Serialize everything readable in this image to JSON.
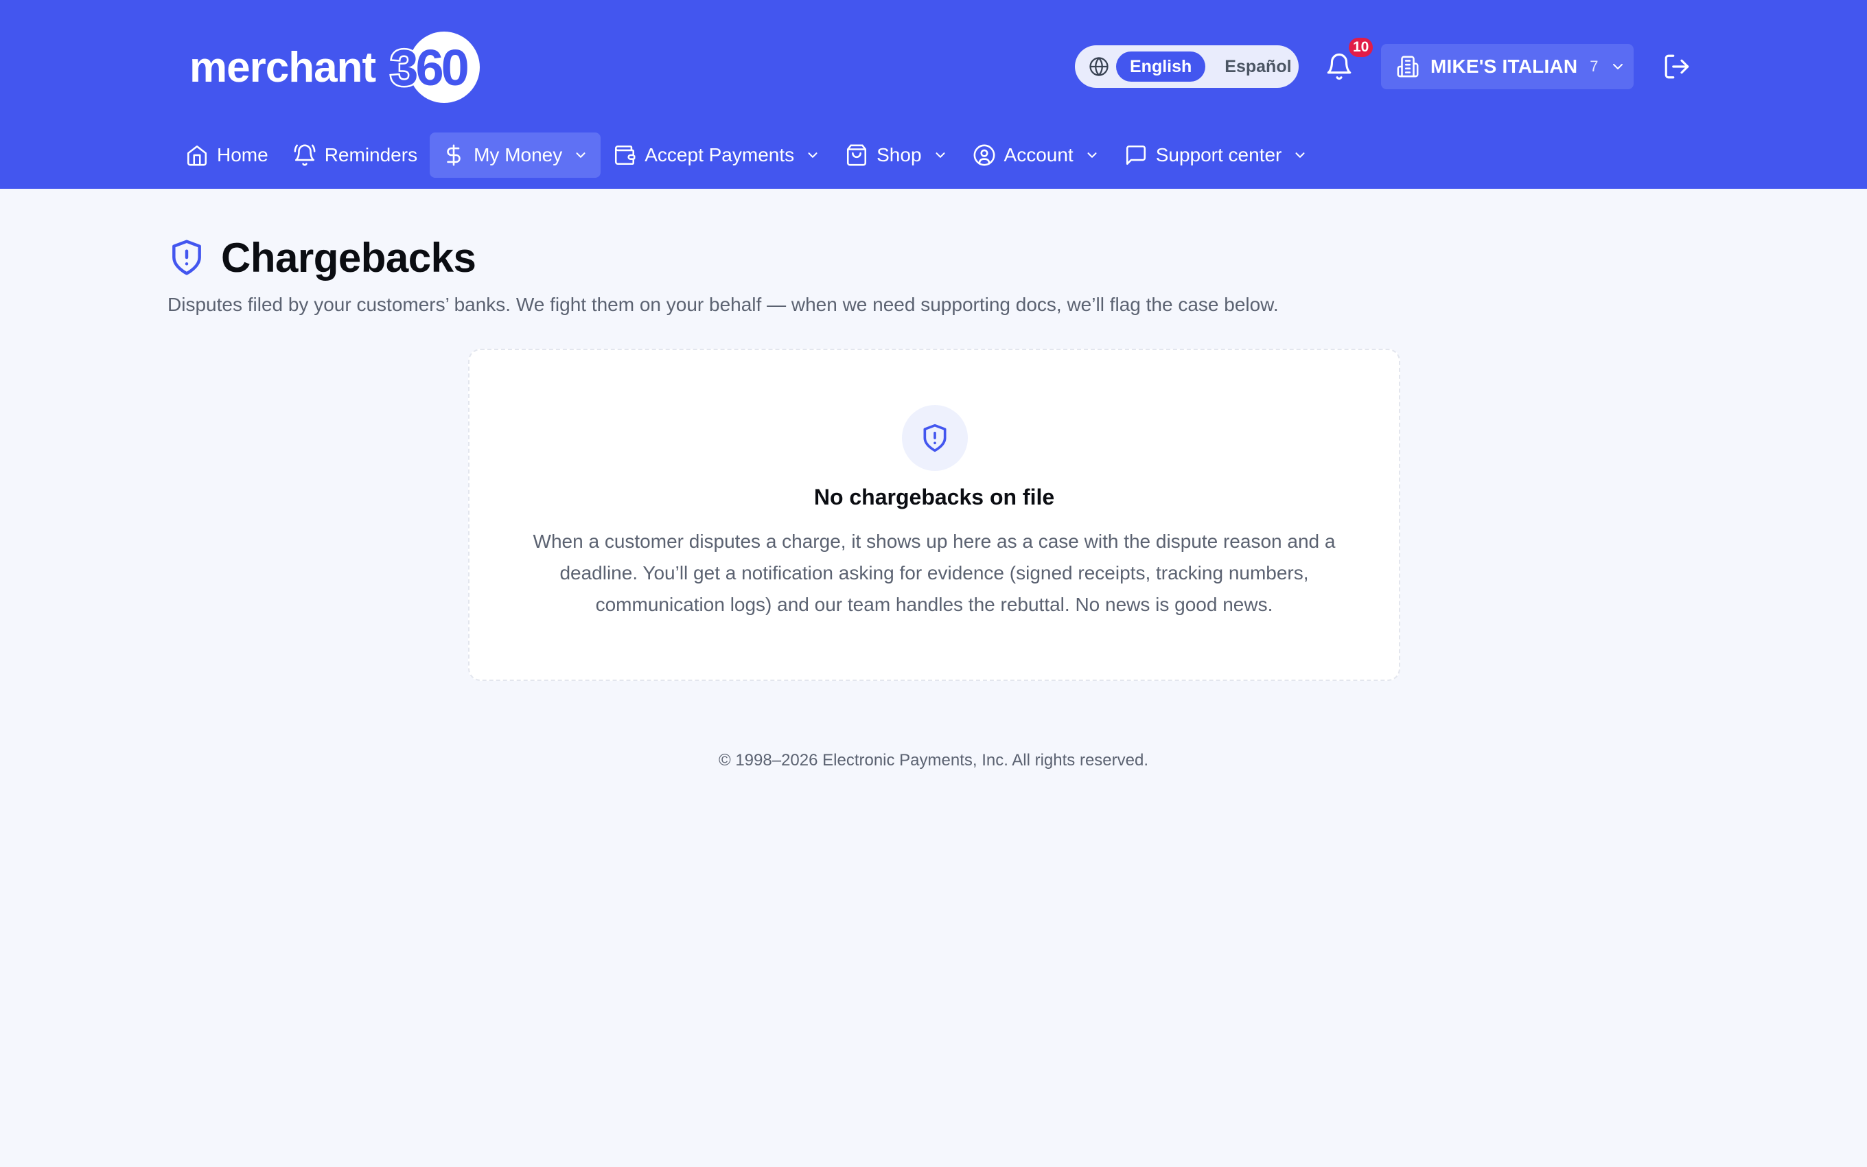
{
  "brand": {
    "logo_text": "merchant",
    "logo_number": "360"
  },
  "header": {
    "language": {
      "options": [
        "English",
        "Español"
      ],
      "selected": "English"
    },
    "notifications": {
      "count": "10"
    },
    "merchant": {
      "name": "MIKE'S ITALIAN",
      "count": "7"
    }
  },
  "nav": {
    "items": [
      {
        "label": "Home",
        "icon": "home-icon",
        "dropdown": false,
        "active": false
      },
      {
        "label": "Reminders",
        "icon": "bell-ring-icon",
        "dropdown": false,
        "active": false
      },
      {
        "label": "My Money",
        "icon": "dollar-icon",
        "dropdown": true,
        "active": true
      },
      {
        "label": "Accept Payments",
        "icon": "wallet-icon",
        "dropdown": true,
        "active": false
      },
      {
        "label": "Shop",
        "icon": "shopping-bag-icon",
        "dropdown": true,
        "active": false
      },
      {
        "label": "Account",
        "icon": "user-circle-icon",
        "dropdown": true,
        "active": false
      },
      {
        "label": "Support center",
        "icon": "message-square-icon",
        "dropdown": true,
        "active": false
      }
    ]
  },
  "page": {
    "title": "Chargebacks",
    "subtitle": "Disputes filed by your customers’ banks. We fight them on your behalf — when we need supporting docs, we’ll flag the case below."
  },
  "empty_state": {
    "icon": "shield-alert-icon",
    "title": "No chargebacks on file",
    "body": "When a customer disputes a charge, it shows up here as a case with the dispute reason and a deadline. You’ll get a notification asking for evidence (signed receipts, tracking numbers, communication logs) and our team handles the rebuttal. No news is good news."
  },
  "footer": {
    "text": "© 1998–2026 Electronic Payments, Inc. All rights reserved."
  },
  "colors": {
    "brand": "#4356ef",
    "background": "#f5f7fd",
    "badge": "#e11d48"
  }
}
